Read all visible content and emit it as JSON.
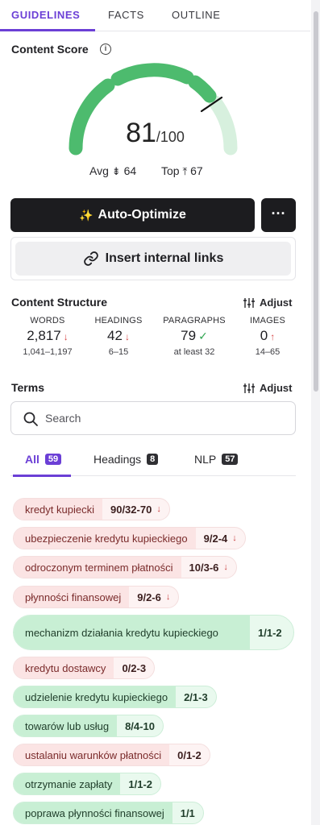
{
  "tabs": [
    {
      "label": "GUIDELINES",
      "active": true
    },
    {
      "label": "FACTS",
      "active": false
    },
    {
      "label": "OUTLINE",
      "active": false
    }
  ],
  "content_score": {
    "title": "Content Score",
    "info_icon": "info-icon",
    "value": "81",
    "max": "/100",
    "avg_label": "Avg",
    "avg_value": "64",
    "top_label": "Top",
    "top_value": "67",
    "gauge_color": "#4dbb6e",
    "gauge_track_color": "#d7f0de"
  },
  "actions": {
    "auto_optimize_label": "Auto-Optimize",
    "more_label": "···",
    "insert_links_label": "Insert internal links"
  },
  "content_structure": {
    "title": "Content Structure",
    "adjust_label": "Adjust",
    "stats": [
      {
        "label": "WORDS",
        "value": "2,817",
        "indicator": "↓",
        "range": "1,041–1,197"
      },
      {
        "label": "HEADINGS",
        "value": "42",
        "indicator": "↓",
        "range": "6–15"
      },
      {
        "label": "PARAGRAPHS",
        "value": "79",
        "indicator": "✓",
        "range": "at least 32"
      },
      {
        "label": "IMAGES",
        "value": "0",
        "indicator": "↑",
        "range": "14–65"
      }
    ]
  },
  "terms": {
    "title": "Terms",
    "adjust_label": "Adjust",
    "search_placeholder": "Search",
    "filters": [
      {
        "label": "All",
        "count": "59",
        "active": true
      },
      {
        "label": "Headings",
        "count": "8",
        "active": false
      },
      {
        "label": "NLP",
        "count": "57",
        "active": false
      }
    ],
    "items": [
      {
        "term": "kredyt kupiecki",
        "count": "90/32-70",
        "status": "over",
        "arrow": "↓"
      },
      {
        "term": "ubezpieczenie kredytu kupieckiego",
        "count": "9/2-4",
        "status": "over",
        "arrow": "↓"
      },
      {
        "term": "odroczonym terminem płatności",
        "count": "10/3-6",
        "status": "over",
        "arrow": "↓"
      },
      {
        "term": "płynności finansowej",
        "count": "9/2-6",
        "status": "over",
        "arrow": "↓"
      },
      {
        "term": "mechanizm działania kredytu kupieckiego",
        "count": "1/1-2",
        "status": "ok",
        "arrow": ""
      },
      {
        "term": "kredytu dostawcy",
        "count": "0/2-3",
        "status": "under",
        "arrow": ""
      },
      {
        "term": "udzielenie kredytu kupieckiego",
        "count": "2/1-3",
        "status": "ok",
        "arrow": ""
      },
      {
        "term": "towarów lub usług",
        "count": "8/4-10",
        "status": "ok",
        "arrow": ""
      },
      {
        "term": "ustalaniu warunków płatności",
        "count": "0/1-2",
        "status": "under",
        "arrow": ""
      },
      {
        "term": "otrzymanie zapłaty",
        "count": "1/1-2",
        "status": "ok",
        "arrow": ""
      },
      {
        "term": "poprawa płynności finansowej",
        "count": "1/1",
        "status": "ok",
        "arrow": ""
      }
    ]
  }
}
